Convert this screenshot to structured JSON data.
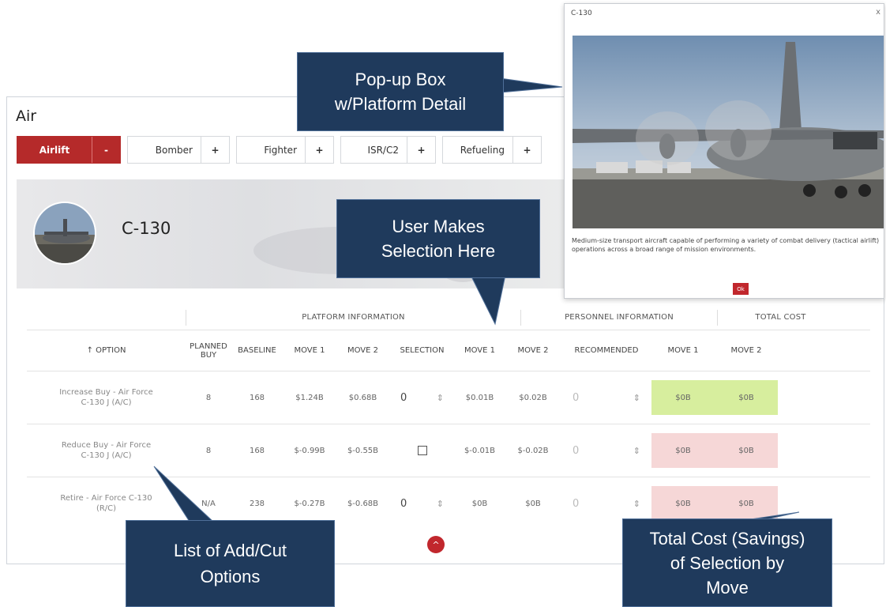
{
  "air": {
    "title": "Air",
    "tabs": [
      {
        "label": "Airlift",
        "toggle": "-"
      },
      {
        "label": "Bomber",
        "toggle": "+"
      },
      {
        "label": "Fighter",
        "toggle": "+"
      },
      {
        "label": "ISR/C2",
        "toggle": "+"
      },
      {
        "label": "Refueling",
        "toggle": "+"
      }
    ],
    "platform_name": "C-130"
  },
  "table": {
    "groups": {
      "platform": "PLATFORM INFORMATION",
      "personnel": "PERSONNEL INFORMATION",
      "total": "TOTAL COST"
    },
    "headers": {
      "option": "↑ OPTION",
      "planned_buy": "PLANNED BUY",
      "baseline": "BASELINE",
      "move1": "MOVE 1",
      "move2": "MOVE 2",
      "selection": "SELECTION",
      "pers_move1": "MOVE 1",
      "pers_move2": "MOVE 2",
      "recommended": "RECOMMENDED",
      "total_move1": "MOVE 1",
      "total_move2": "MOVE 2"
    },
    "rows": [
      {
        "option": "Increase Buy - Air Force C-130 J (A/C)",
        "planned_buy": "8",
        "baseline": "168",
        "move1": "$1.24B",
        "move2": "$0.68B",
        "selection": "0",
        "pers_move1": "$0.01B",
        "pers_move2": "$0.02B",
        "recommended": "0",
        "total_move1": "$0B",
        "total_move2": "$0B"
      },
      {
        "option": "Reduce Buy - Air Force C-130 J (A/C)",
        "planned_buy": "8",
        "baseline": "168",
        "move1": "$-0.99B",
        "move2": "$-0.55B",
        "selection": "",
        "pers_move1": "$-0.01B",
        "pers_move2": "$-0.02B",
        "recommended": "0",
        "total_move1": "$0B",
        "total_move2": "$0B"
      },
      {
        "option": "Retire - Air Force C-130 (R/C)",
        "planned_buy": "N/A",
        "baseline": "238",
        "move1": "$-0.27B",
        "move2": "$-0.68B",
        "selection": "0",
        "pers_move1": "$0B",
        "pers_move2": "$0B",
        "recommended": "0",
        "total_move1": "$0B",
        "total_move2": "$0B"
      }
    ]
  },
  "scroll_up_icon": "^",
  "popup": {
    "title": "C-130",
    "close": "x",
    "description": "Medium-size transport aircraft capable of performing a variety of combat delivery (tactical airlift) operations across a broad range of mission environments.",
    "ok_label": "Ok"
  },
  "callouts": {
    "popup_box": [
      "Pop-up Box",
      "w/Platform Detail"
    ],
    "user_selection": [
      "User Makes",
      "Selection Here"
    ],
    "options_list": [
      "List of Add/Cut",
      "Options"
    ],
    "total_cost": [
      "Total Cost (Savings)",
      "of Selection by",
      "Move"
    ]
  },
  "colors": {
    "accent": "#b52a2a",
    "callout": "#1f3a5c",
    "cost_green": "#d7ee9e",
    "cost_pink": "#f6d7d7"
  }
}
